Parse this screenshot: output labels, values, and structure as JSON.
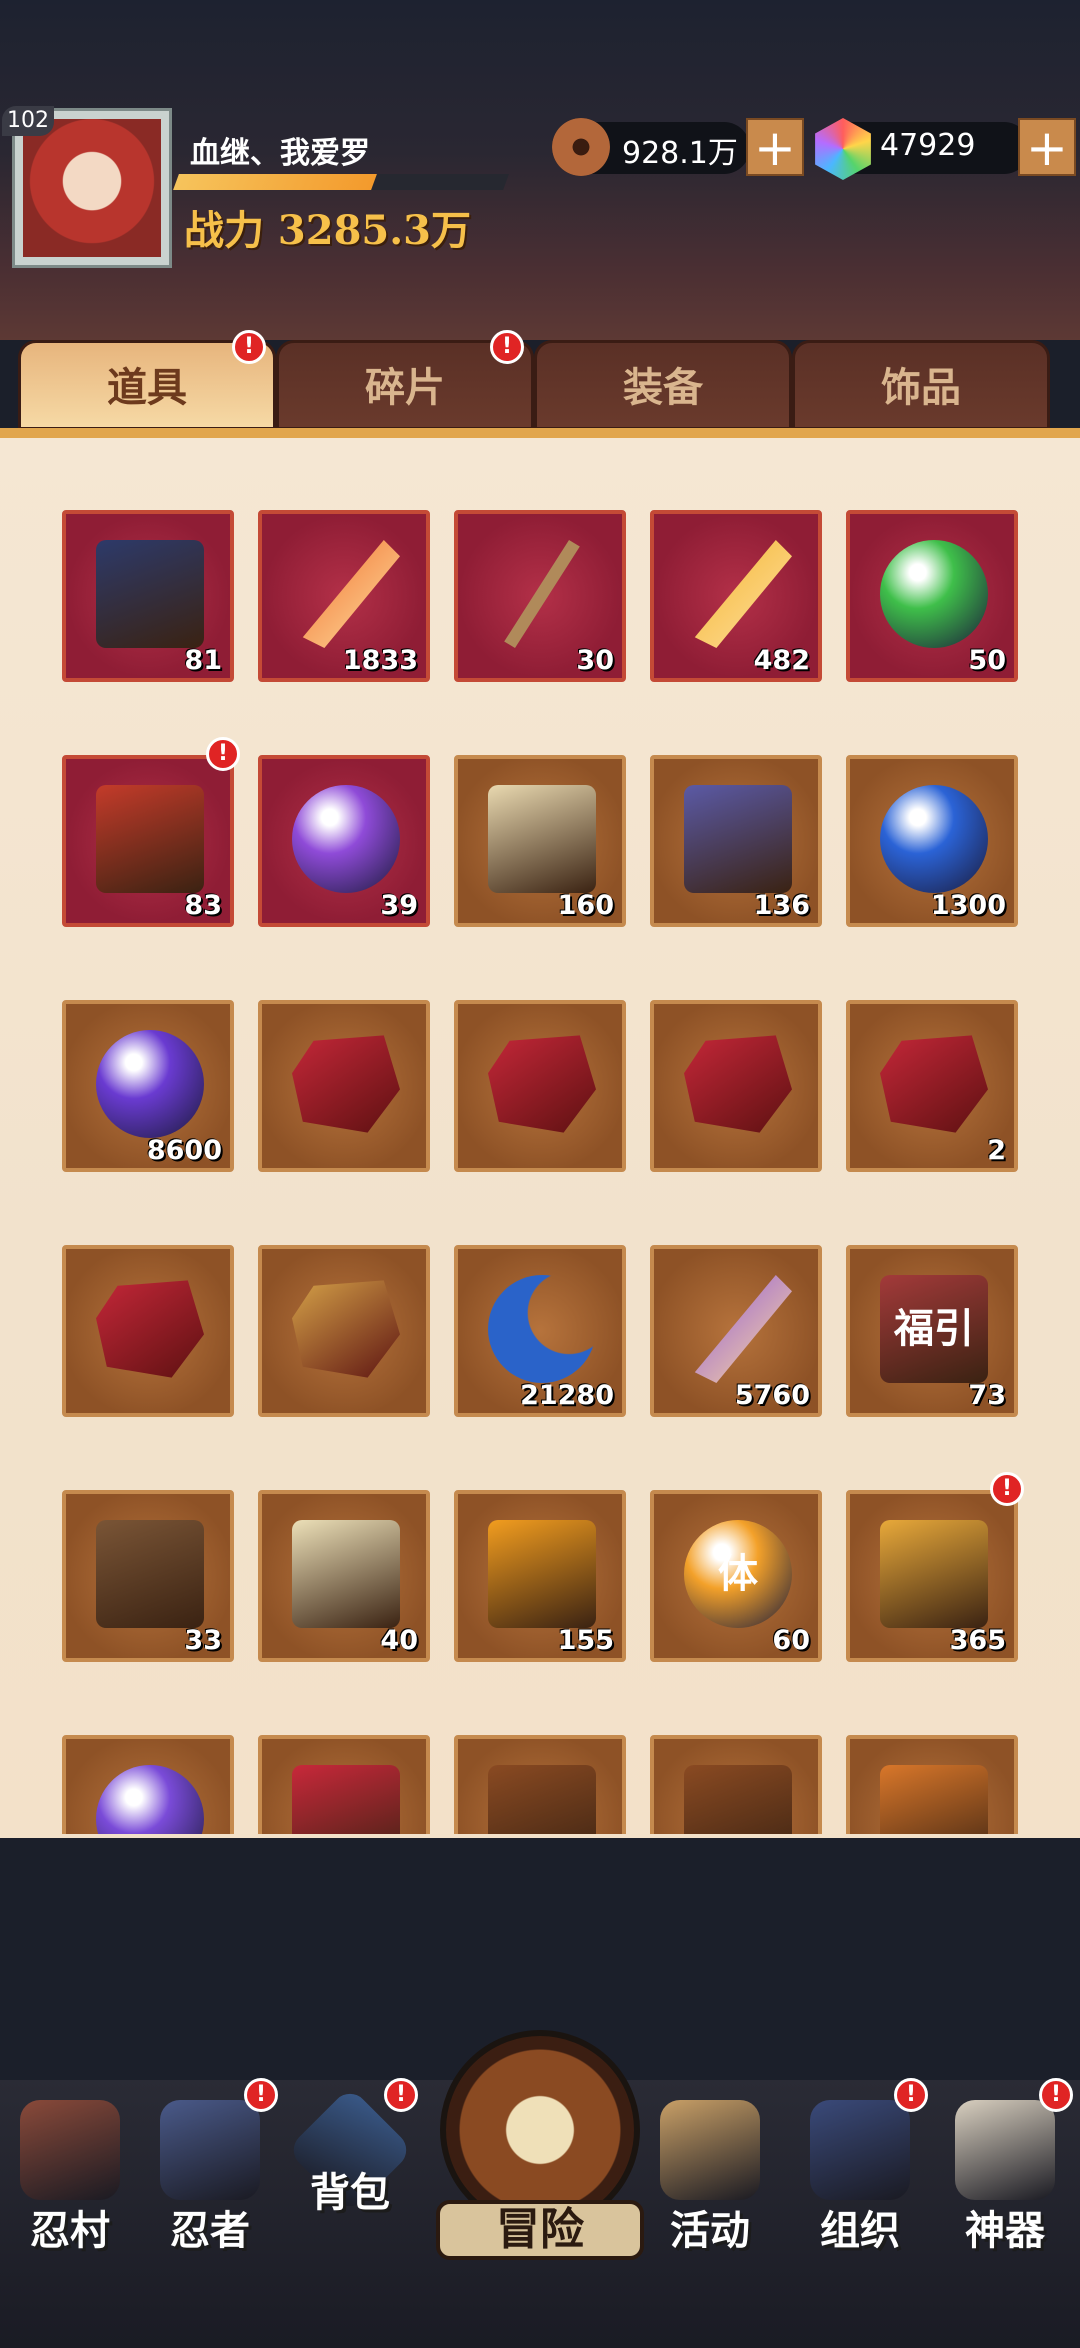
{
  "player": {
    "level": "102",
    "name": "血继、我爱罗",
    "exp_fraction": 0.6,
    "power": "战力 3285.3万"
  },
  "resources": {
    "coins": "928.1万",
    "gems": "47929",
    "plus": "+"
  },
  "tabs": [
    {
      "label": "道具",
      "badge": true,
      "active": true
    },
    {
      "label": "碎片",
      "badge": true,
      "active": false
    },
    {
      "label": "装备",
      "badge": false,
      "active": false
    },
    {
      "label": "饰品",
      "badge": false,
      "active": false
    }
  ],
  "badge_text": "!",
  "items": [
    {
      "icon": "scroll-icon",
      "count": "81",
      "bg": "red",
      "color": "#2d3a6a"
    },
    {
      "icon": "feather-icon",
      "count": "1833",
      "bg": "red",
      "color": "#f06b2a"
    },
    {
      "icon": "stick-icon",
      "count": "30",
      "bg": "red",
      "color": "#b08a5a"
    },
    {
      "icon": "golden-feather-icon",
      "count": "482",
      "bg": "red",
      "color": "#f3b32c"
    },
    {
      "icon": "jade-charm-icon",
      "count": "50",
      "bg": "red",
      "color": "#3fbf4a"
    },
    {
      "icon": "gift-box-icon",
      "count": "83",
      "bg": "red",
      "color": "#c43b2a",
      "badge": true
    },
    {
      "icon": "all-orb-icon",
      "count": "39",
      "bg": "red",
      "color": "#8f4bd8"
    },
    {
      "icon": "map-scroll-icon",
      "count": "160",
      "bg": "brown",
      "color": "#e9d9b0"
    },
    {
      "icon": "banner-icon",
      "count": "136",
      "bg": "brown",
      "color": "#5b5aa6"
    },
    {
      "icon": "blue-orb-icon",
      "count": "1300",
      "bg": "brown",
      "color": "#2b63d6"
    },
    {
      "icon": "purple-orb-icon",
      "count": "8600",
      "bg": "brown",
      "color": "#6a3bd1"
    },
    {
      "icon": "shield-stone-icon",
      "count": "",
      "bg": "brown",
      "color": "#c8283a"
    },
    {
      "icon": "fist-stone-icon",
      "count": "",
      "bg": "brown",
      "color": "#c8283a"
    },
    {
      "icon": "brush-stone-icon",
      "count": "",
      "bg": "brown",
      "color": "#c8283a"
    },
    {
      "icon": "target-stone-icon",
      "count": "2",
      "bg": "brown",
      "color": "#c8283a"
    },
    {
      "icon": "eye-stone-icon",
      "count": "",
      "bg": "brown",
      "color": "#c8283a"
    },
    {
      "icon": "gold-stone-icon",
      "count": "",
      "bg": "brown",
      "color": "#d9a64a"
    },
    {
      "icon": "moon-icon",
      "count": "21280",
      "bg": "brown",
      "color": "#2a63c9"
    },
    {
      "icon": "crystal-icon",
      "count": "5760",
      "bg": "brown",
      "color": "#8b4fd9"
    },
    {
      "icon": "fortune-ticket-icon",
      "count": "73",
      "bg": "brown",
      "color": "#a33a3a",
      "text": "福引"
    },
    {
      "icon": "key-icon",
      "count": "33",
      "bg": "brown",
      "color": "#7a5536"
    },
    {
      "icon": "talisman-icon",
      "count": "40",
      "bg": "brown",
      "color": "#ece0b8"
    },
    {
      "icon": "amber-icon",
      "count": "155",
      "bg": "brown",
      "color": "#f29d1f"
    },
    {
      "icon": "stamina-medal-icon",
      "count": "60",
      "bg": "brown",
      "color": "#f3a12a",
      "text": "体"
    },
    {
      "icon": "golden-box-icon",
      "count": "365",
      "bg": "brown",
      "color": "#e8a93a",
      "badge": true
    },
    {
      "icon": "all-orb-icon",
      "count": "",
      "bg": "brown",
      "color": "#7a4bd8"
    },
    {
      "icon": "fan-icon",
      "count": "",
      "bg": "brown",
      "color": "#c8283a"
    },
    {
      "icon": "rope-icon",
      "count": "",
      "bg": "brown",
      "color": "#8a4a22"
    },
    {
      "icon": "gourd-icon",
      "count": "",
      "bg": "brown",
      "color": "#8a4a22"
    },
    {
      "icon": "jar-icon",
      "count": "",
      "bg": "brown",
      "color": "#d9772a"
    }
  ],
  "nav": [
    {
      "label": "忍村",
      "icon": "village-gate-icon",
      "badge": false
    },
    {
      "label": "忍者",
      "icon": "ninja-icon",
      "badge": true
    },
    {
      "label": "背包",
      "icon": "backpack-icon",
      "badge": true
    },
    {
      "label": "活动",
      "icon": "drum-icon",
      "badge": false
    },
    {
      "label": "组织",
      "icon": "organization-icon",
      "badge": true
    },
    {
      "label": "神器",
      "icon": "artifact-scroll-icon",
      "badge": true
    }
  ],
  "adventure": {
    "label": "冒险"
  }
}
